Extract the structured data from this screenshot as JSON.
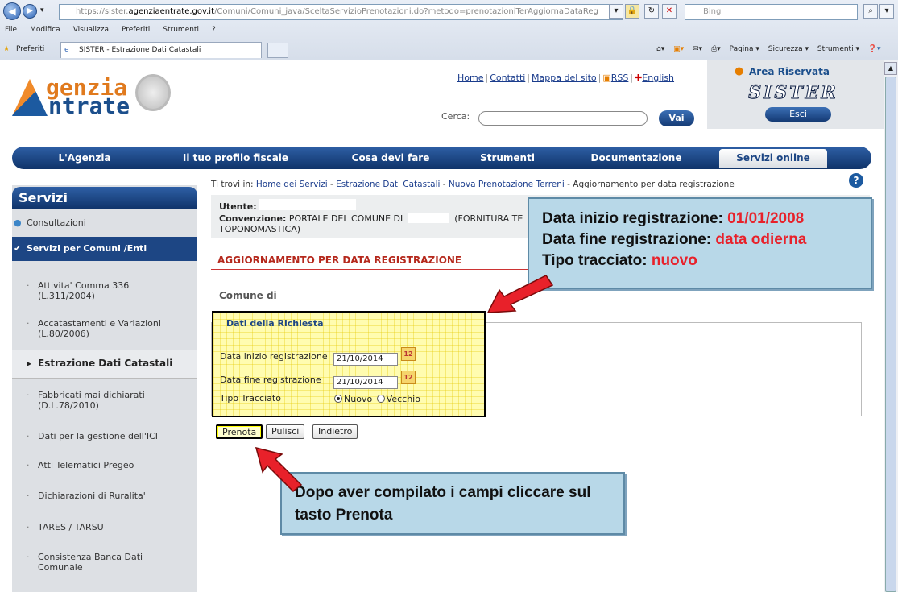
{
  "browser": {
    "url_prefix": "https://sister.",
    "url_domain": "agenziaentrate.gov.it",
    "url_path": "/Comuni/Comuni_java/SceltaServizioPrenotazioni.do?metodo=prenotazioniTerAggiornaDataReg",
    "search_placeholder": "Bing",
    "menu": [
      "File",
      "Modifica",
      "Visualizza",
      "Preferiti",
      "Strumenti",
      "?"
    ],
    "favorites_label": "Preferiti",
    "tab_title": "SISTER - Estrazione Dati Catastali",
    "tools": [
      "Pagina ▾",
      "Sicurezza ▾",
      "Strumenti ▾"
    ]
  },
  "header": {
    "logo_line1": "genzia",
    "logo_line2": "ntrate",
    "links": [
      "Home",
      "Contatti",
      "Mappa del sito",
      "RSS",
      "English"
    ],
    "search_label": "Cerca:",
    "search_button": "Vai",
    "reserved_title": "Area Riservata",
    "sister_logo": "SISTER",
    "logout_button": "Esci"
  },
  "nav": {
    "items": [
      "L'Agenzia",
      "Il tuo profilo fiscale",
      "Cosa devi fare",
      "Strumenti",
      "Documentazione",
      "Servizi online"
    ]
  },
  "sidebar": {
    "title": "Servizi",
    "consultazioni": "Consultazioni",
    "active": "Servizi per Comuni /Enti",
    "items": [
      {
        "line1": "Attivita' Comma 336",
        "line2": "(L.311/2004)"
      },
      {
        "line1": "Accatastamenti e Variazioni",
        "line2": "(L.80/2006)"
      },
      {
        "line1": "Estrazione Dati Catastali",
        "line2": ""
      },
      {
        "line1": "Fabbricati mai dichiarati",
        "line2": "(D.L.78/2010)"
      },
      {
        "line1": "Dati per la gestione dell'ICI",
        "line2": ""
      },
      {
        "line1": "Atti Telematici Pregeo",
        "line2": ""
      },
      {
        "line1": "Dichiarazioni di Ruralita'",
        "line2": ""
      },
      {
        "line1": "TARES / TARSU",
        "line2": ""
      },
      {
        "line1": "Consistenza Banca Dati",
        "line2": "Comunale"
      }
    ]
  },
  "breadcrumb": {
    "prefix": "Ti trovi in:",
    "links": [
      "Home dei Servizi",
      "Estrazione Dati Catastali",
      "Nuova Prenotazione Terreni"
    ],
    "current": "Aggiornamento per data registrazione"
  },
  "user": {
    "utente_label": "Utente:",
    "convenzione_label": "Convenzione:",
    "convenzione_value": "PORTALE DEL COMUNE DI",
    "fornitura": "(FORNITURA TE",
    "line3": "TOPONOMASTICA)"
  },
  "form": {
    "section_title": "AGGIORNAMENTO PER DATA REGISTRAZIONE",
    "comune_label": "Comune di",
    "fieldset_title": "Dati della Richiesta",
    "data_inizio_label": "Data inizio registrazione",
    "data_inizio_value": "21/10/2014",
    "data_fine_label": "Data fine registrazione",
    "data_fine_value": "21/10/2014",
    "tipo_label": "Tipo Tracciato",
    "tipo_options": [
      "Nuovo",
      "Vecchio"
    ],
    "tipo_selected": "Nuovo",
    "buttons": {
      "prenota": "Prenota",
      "pulisci": "Pulisci",
      "indietro": "Indietro"
    }
  },
  "callouts": {
    "c1": {
      "l1_label": "Data inizio registrazione: ",
      "l1_value": "01/01/2008",
      "l2_label": "Data fine registrazione: ",
      "l2_value": "data odierna",
      "l3_label": "Tipo tracciato: ",
      "l3_value": "nuovo"
    },
    "c2": {
      "text": "Dopo aver compilato i campi cliccare sul tasto Prenota"
    }
  },
  "colors": {
    "accent_blue": "#1d4684",
    "alert_red": "#e8212a",
    "callout_bg": "#b8d8e8"
  }
}
